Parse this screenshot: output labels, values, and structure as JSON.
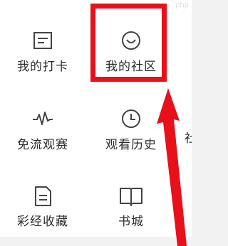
{
  "grid": {
    "items": [
      {
        "label": "我的打卡",
        "icon": "card-icon"
      },
      {
        "label": "我的社区",
        "icon": "smile-chat-icon"
      },
      {
        "label": "免流观赛",
        "icon": "pulse-icon"
      },
      {
        "label": "观看历史",
        "icon": "clock-icon"
      },
      {
        "label": "彩经收藏",
        "icon": "document-icon"
      },
      {
        "label": "书城",
        "icon": "book-icon"
      }
    ],
    "partial_label": "社"
  },
  "annotation": {
    "highlight_color": "#e8101a",
    "arrow_color": "#e8101a"
  },
  "colors": {
    "icon": "#444444",
    "text": "#2a2a2a",
    "background": "#ffffff"
  }
}
